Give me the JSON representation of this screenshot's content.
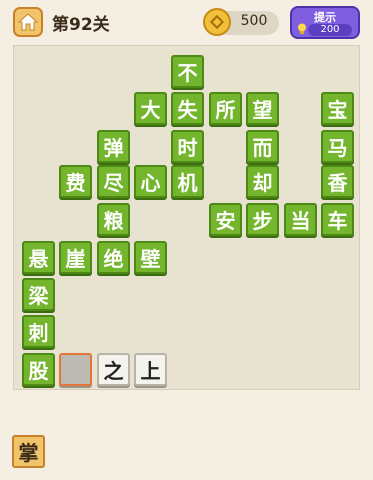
{
  "header": {
    "level_title": "第92关",
    "coins": "500",
    "hint_label": "提示",
    "hint_cost": "200"
  },
  "colors": {
    "tile_green": "#73b52c",
    "hint_purple": "#7f5fe0",
    "coin_gold": "#f0c03a",
    "selected_border": "#e3743a"
  },
  "board": {
    "tiles": [
      {
        "char": "不",
        "style": "green"
      },
      {
        "char": "大",
        "style": "green"
      },
      {
        "char": "失",
        "style": "green"
      },
      {
        "char": "所",
        "style": "green"
      },
      {
        "char": "望",
        "style": "green"
      },
      {
        "char": "宝",
        "style": "green"
      },
      {
        "char": "弹",
        "style": "green"
      },
      {
        "char": "时",
        "style": "green"
      },
      {
        "char": "而",
        "style": "green"
      },
      {
        "char": "马",
        "style": "green"
      },
      {
        "char": "费",
        "style": "green"
      },
      {
        "char": "尽",
        "style": "green"
      },
      {
        "char": "心",
        "style": "green"
      },
      {
        "char": "机",
        "style": "green"
      },
      {
        "char": "却",
        "style": "green"
      },
      {
        "char": "香",
        "style": "green"
      },
      {
        "char": "粮",
        "style": "green"
      },
      {
        "char": "安",
        "style": "green"
      },
      {
        "char": "步",
        "style": "green"
      },
      {
        "char": "当",
        "style": "green"
      },
      {
        "char": "车",
        "style": "green"
      },
      {
        "char": "悬",
        "style": "green"
      },
      {
        "char": "崖",
        "style": "green"
      },
      {
        "char": "绝",
        "style": "green"
      },
      {
        "char": "壁",
        "style": "green"
      },
      {
        "char": "梁",
        "style": "green"
      },
      {
        "char": "刺",
        "style": "green"
      },
      {
        "char": "股",
        "style": "green"
      },
      {
        "char": "",
        "style": "empty"
      },
      {
        "char": "之",
        "style": "white"
      },
      {
        "char": "上",
        "style": "white"
      }
    ]
  },
  "answer_bank": [
    {
      "char": "掌"
    }
  ]
}
